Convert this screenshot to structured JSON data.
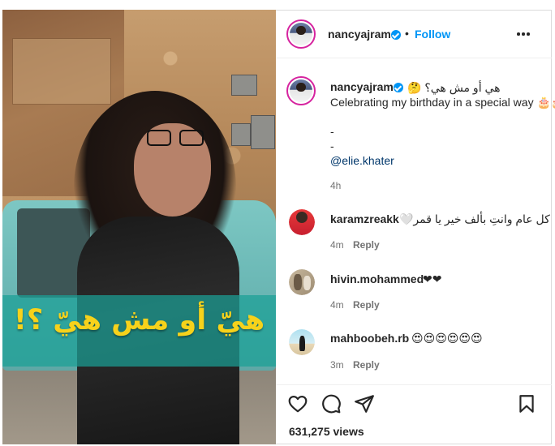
{
  "post": {
    "author": "nancyajram",
    "follow_label": "Follow",
    "separator": "•",
    "media_overlay_text": "هيّ أو مش هيّ ؟!"
  },
  "caption": {
    "username": "nancyajram",
    "line1": "هي أو مش هي؟ 🤔",
    "line2": "Celebrating my birthday in a special way 🎂🎂🎂",
    "line3": "-",
    "line4": "-",
    "mention": "@elie.khater",
    "time": "4h"
  },
  "comments": [
    {
      "username": "karamzreakk",
      "text": "كل عام وانتِ بألف خير يا قمر🤍",
      "time": "4m",
      "reply_label": "Reply"
    },
    {
      "username": "hivin.mohammed",
      "text": "❤❤",
      "time": "4m",
      "reply_label": "Reply"
    },
    {
      "username": "mahboobeh.rb",
      "text": "😍😍😍😍😍😍",
      "time": "3m",
      "reply_label": "Reply"
    }
  ],
  "stats": {
    "views": "631,275 views"
  },
  "icons": [
    "verified-badge-icon",
    "more-options-icon",
    "heart-icon",
    "comment-icon",
    "share-icon",
    "bookmark-icon"
  ],
  "colors": {
    "accent": "#0095f6",
    "text": "#262626",
    "muted": "#737373",
    "overlay_text": "#f6d21b",
    "overlay_band": "#1aa096"
  }
}
